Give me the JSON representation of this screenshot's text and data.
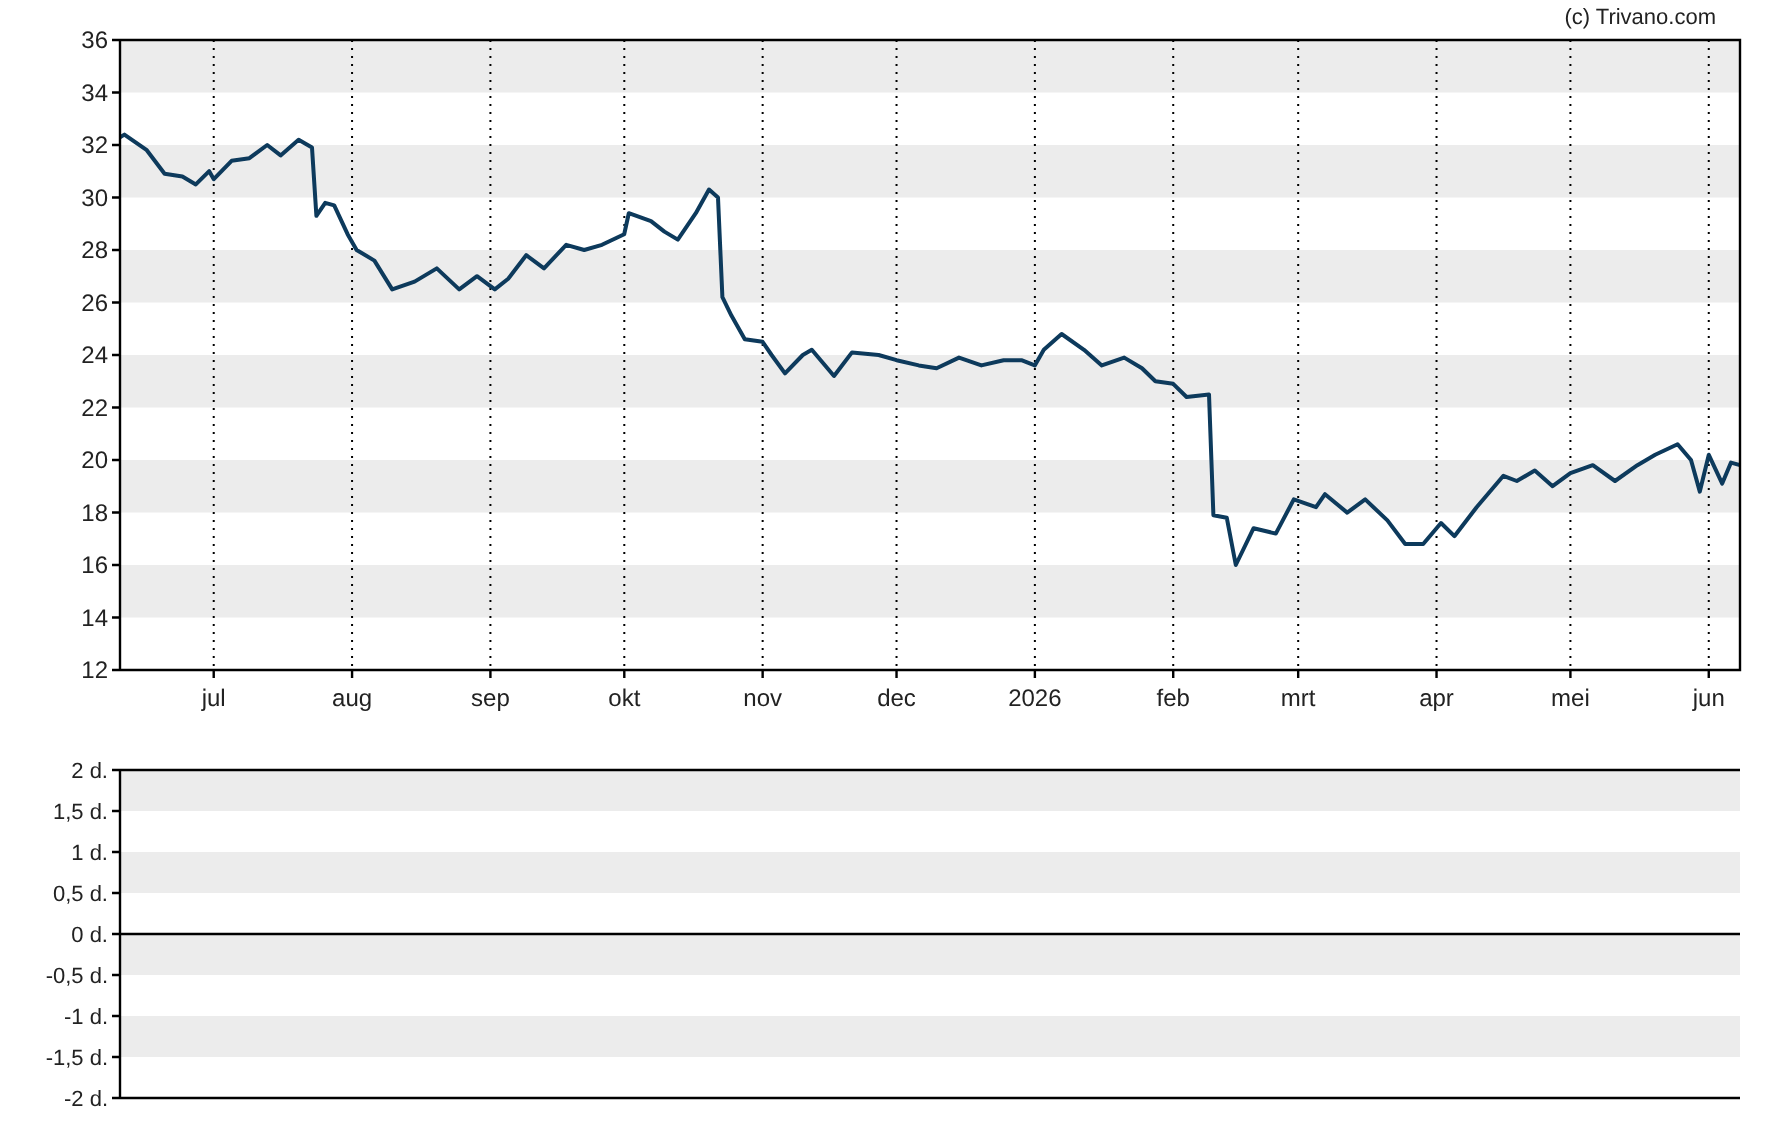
{
  "credit": "(c) Trivano.com",
  "price_chart": {
    "chart_data": {
      "type": "line",
      "grid": true,
      "xlim": [
        "2025-06-10",
        "2026-06-08"
      ],
      "ylim": [
        12,
        36
      ],
      "yticks": [
        12,
        14,
        16,
        18,
        20,
        22,
        24,
        26,
        28,
        30,
        32,
        34,
        36
      ],
      "xticks": [
        {
          "value": "2025-07-01",
          "label": "jul"
        },
        {
          "value": "2025-08-01",
          "label": "aug"
        },
        {
          "value": "2025-09-01",
          "label": "sep"
        },
        {
          "value": "2025-10-01",
          "label": "okt"
        },
        {
          "value": "2025-11-01",
          "label": "nov"
        },
        {
          "value": "2025-12-01",
          "label": "dec"
        },
        {
          "value": "2026-01-01",
          "label": "2026"
        },
        {
          "value": "2026-02-01",
          "label": "feb"
        },
        {
          "value": "2026-03-01",
          "label": "mrt"
        },
        {
          "value": "2026-04-01",
          "label": "apr"
        },
        {
          "value": "2026-05-01",
          "label": "mei"
        },
        {
          "value": "2026-06-01",
          "label": "jun"
        }
      ],
      "series": [
        {
          "color": "#0d3a5c",
          "x": [
            "2025-06-10",
            "2025-06-11",
            "2025-06-16",
            "2025-06-20",
            "2025-06-24",
            "2025-06-27",
            "2025-06-30",
            "2025-07-01",
            "2025-07-05",
            "2025-07-09",
            "2025-07-13",
            "2025-07-16",
            "2025-07-20",
            "2025-07-23",
            "2025-07-24",
            "2025-07-26",
            "2025-07-28",
            "2025-07-31",
            "2025-08-02",
            "2025-08-06",
            "2025-08-10",
            "2025-08-15",
            "2025-08-20",
            "2025-08-25",
            "2025-08-29",
            "2025-09-02",
            "2025-09-05",
            "2025-09-09",
            "2025-09-13",
            "2025-09-18",
            "2025-09-22",
            "2025-09-26",
            "2025-10-01",
            "2025-10-02",
            "2025-10-07",
            "2025-10-10",
            "2025-10-13",
            "2025-10-17",
            "2025-10-20",
            "2025-10-22",
            "2025-10-23",
            "2025-10-25",
            "2025-10-28",
            "2025-11-01",
            "2025-11-03",
            "2025-11-06",
            "2025-11-10",
            "2025-11-12",
            "2025-11-17",
            "2025-11-21",
            "2025-11-27",
            "2025-12-01",
            "2025-12-06",
            "2025-12-10",
            "2025-12-15",
            "2025-12-20",
            "2025-12-25",
            "2025-12-29",
            "2026-01-01",
            "2026-01-03",
            "2026-01-07",
            "2026-01-12",
            "2026-01-16",
            "2026-01-21",
            "2026-01-25",
            "2026-01-28",
            "2026-02-01",
            "2026-02-04",
            "2026-02-09",
            "2026-02-10",
            "2026-02-13",
            "2026-02-15",
            "2026-02-19",
            "2026-02-24",
            "2026-02-28",
            "2026-03-05",
            "2026-03-07",
            "2026-03-12",
            "2026-03-16",
            "2026-03-21",
            "2026-03-25",
            "2026-03-29",
            "2026-04-02",
            "2026-04-05",
            "2026-04-10",
            "2026-04-16",
            "2026-04-19",
            "2026-04-23",
            "2026-04-27",
            "2026-05-01",
            "2026-05-06",
            "2026-05-11",
            "2026-05-16",
            "2026-05-20",
            "2026-05-25",
            "2026-05-28",
            "2026-05-30",
            "2026-06-01",
            "2026-06-04",
            "2026-06-06",
            "2026-06-08"
          ],
          "values": [
            32.3,
            32.4,
            31.8,
            30.9,
            30.8,
            30.5,
            31,
            30.7,
            31.4,
            31.5,
            32,
            31.6,
            32.2,
            31.9,
            29.3,
            29.8,
            29.7,
            28.6,
            28,
            27.6,
            26.5,
            26.8,
            27.3,
            26.5,
            27,
            26.5,
            26.9,
            27.8,
            27.3,
            28.2,
            28,
            28.2,
            28.6,
            29.4,
            29.1,
            28.7,
            28.4,
            29.4,
            30.3,
            30,
            26.2,
            25.5,
            24.6,
            24.5,
            24,
            23.3,
            24,
            24.2,
            23.2,
            24.1,
            24,
            23.8,
            23.6,
            23.5,
            23.9,
            23.6,
            23.8,
            23.8,
            23.6,
            24.2,
            24.8,
            24.2,
            23.6,
            23.9,
            23.5,
            23,
            22.9,
            22.4,
            22.5,
            17.9,
            17.8,
            16,
            17.4,
            17.2,
            18.5,
            18.2,
            18.7,
            18,
            18.5,
            17.7,
            16.8,
            16.8,
            17.6,
            17.1,
            18.2,
            19.4,
            19.2,
            19.6,
            19,
            19.5,
            19.8,
            19.2,
            19.8,
            20.2,
            20.6,
            20,
            18.8,
            20.2,
            19.1,
            19.9,
            19.8
          ]
        }
      ]
    }
  },
  "volume_chart": {
    "axis_labels": [
      "2 d.",
      "1,5 d.",
      "1 d.",
      "0,5 d.",
      "0 d.",
      "-0,5 d.",
      "-1 d.",
      "-1,5 d.",
      "-2 d."
    ]
  }
}
